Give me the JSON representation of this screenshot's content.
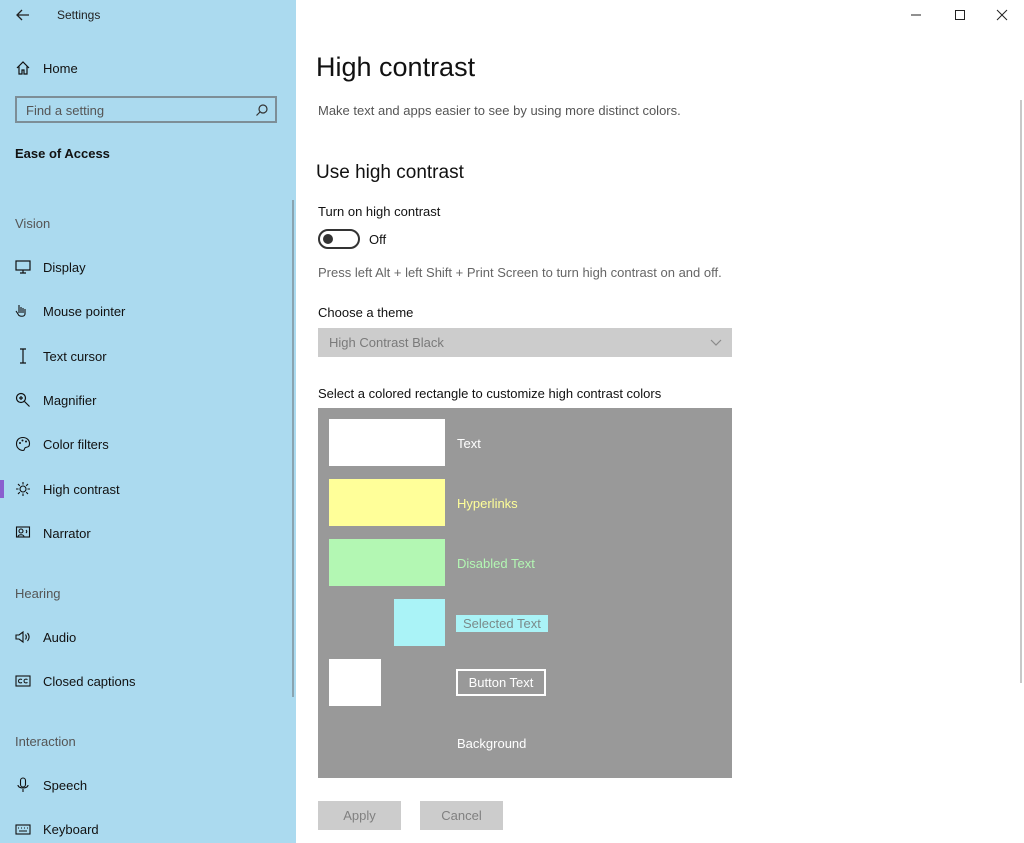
{
  "app": {
    "title": "Settings"
  },
  "sidebar": {
    "home_label": "Home",
    "search_placeholder": "Find a setting",
    "section_title": "Ease of Access",
    "groups": {
      "vision": "Vision",
      "hearing": "Hearing",
      "interaction": "Interaction"
    },
    "items": [
      {
        "label": "Display",
        "icon": "display-icon"
      },
      {
        "label": "Mouse pointer",
        "icon": "mouse-pointer-icon"
      },
      {
        "label": "Text cursor",
        "icon": "text-cursor-icon"
      },
      {
        "label": "Magnifier",
        "icon": "magnifier-icon"
      },
      {
        "label": "Color filters",
        "icon": "color-filters-icon"
      },
      {
        "label": "High contrast",
        "icon": "high-contrast-icon",
        "active": true
      },
      {
        "label": "Narrator",
        "icon": "narrator-icon"
      },
      {
        "label": "Audio",
        "icon": "audio-icon"
      },
      {
        "label": "Closed captions",
        "icon": "closed-captions-icon"
      },
      {
        "label": "Speech",
        "icon": "speech-icon"
      },
      {
        "label": "Keyboard",
        "icon": "keyboard-icon"
      }
    ]
  },
  "main": {
    "title": "High contrast",
    "subtitle": "Make text and apps easier to see by using more distinct colors.",
    "section_heading": "Use high contrast",
    "toggle_label": "Turn on high contrast",
    "toggle_state": "Off",
    "shortcut_hint": "Press left Alt + left Shift + Print Screen to turn high contrast on and off.",
    "theme_label": "Choose a theme",
    "theme_value": "High Contrast Black",
    "palette_label": "Select a colored rectangle to customize high contrast colors",
    "palette": {
      "text": "Text",
      "hyperlinks": "Hyperlinks",
      "disabled_text": "Disabled Text",
      "selected_text": "Selected Text",
      "button_text": "Button Text",
      "background": "Background"
    },
    "apply_label": "Apply",
    "cancel_label": "Cancel"
  },
  "colors": {
    "sidebar_bg": "#abdaef",
    "text_swatch": "#ffffff",
    "hyperlink_swatch": "#ffff99",
    "disabled_swatch": "#b3f7b3",
    "selected_swatch": "#aaf3f7",
    "button_swatch": "#ffffff",
    "palette_bg": "#999999",
    "accent": "#8a5fcf"
  }
}
